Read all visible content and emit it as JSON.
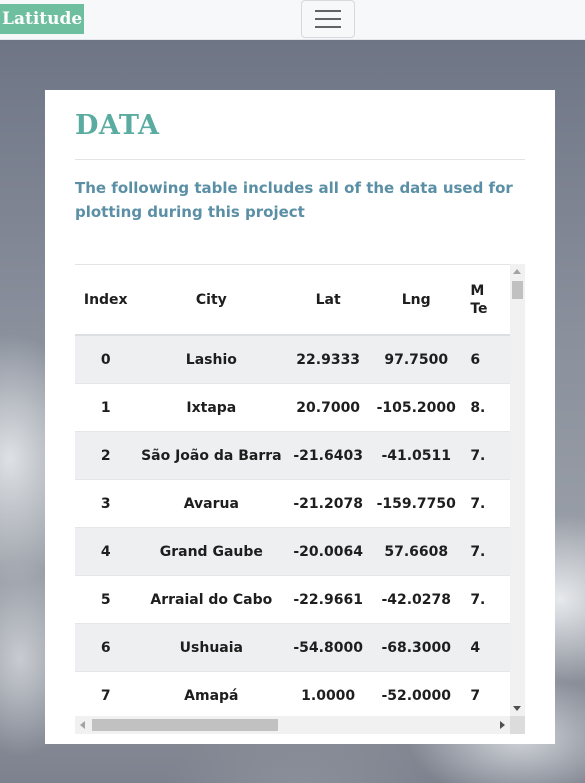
{
  "navbar": {
    "brand": "Latitude",
    "toggle_icon": "hamburger-menu-icon"
  },
  "card": {
    "title": "DATA",
    "description": "The following table includes all of the data used for plotting during this project"
  },
  "table": {
    "headers": {
      "index": "Index",
      "city": "City",
      "lat": "Lat",
      "lng": "Lng",
      "max_temp": "M\nTe"
    },
    "rows": [
      {
        "index": "0",
        "city": "Lashio",
        "lat": "22.9333",
        "lng": "97.7500",
        "max_temp": "6"
      },
      {
        "index": "1",
        "city": "Ixtapa",
        "lat": "20.7000",
        "lng": "-105.2000",
        "max_temp": "8."
      },
      {
        "index": "2",
        "city": "São João da Barra",
        "lat": "-21.6403",
        "lng": "-41.0511",
        "max_temp": "7."
      },
      {
        "index": "3",
        "city": "Avarua",
        "lat": "-21.2078",
        "lng": "-159.7750",
        "max_temp": "7."
      },
      {
        "index": "4",
        "city": "Grand Gaube",
        "lat": "-20.0064",
        "lng": "57.6608",
        "max_temp": "7."
      },
      {
        "index": "5",
        "city": "Arraial do Cabo",
        "lat": "-22.9661",
        "lng": "-42.0278",
        "max_temp": "7."
      },
      {
        "index": "6",
        "city": "Ushuaia",
        "lat": "-54.8000",
        "lng": "-68.3000",
        "max_temp": "4"
      },
      {
        "index": "7",
        "city": "Amapá",
        "lat": "1.0000",
        "lng": "-52.0000",
        "max_temp": "7"
      }
    ]
  },
  "colors": {
    "brand_bg": "#6dbf9f",
    "title": "#5aaba0",
    "description": "#5a8fa6",
    "striped_row": "#eeeff0"
  }
}
